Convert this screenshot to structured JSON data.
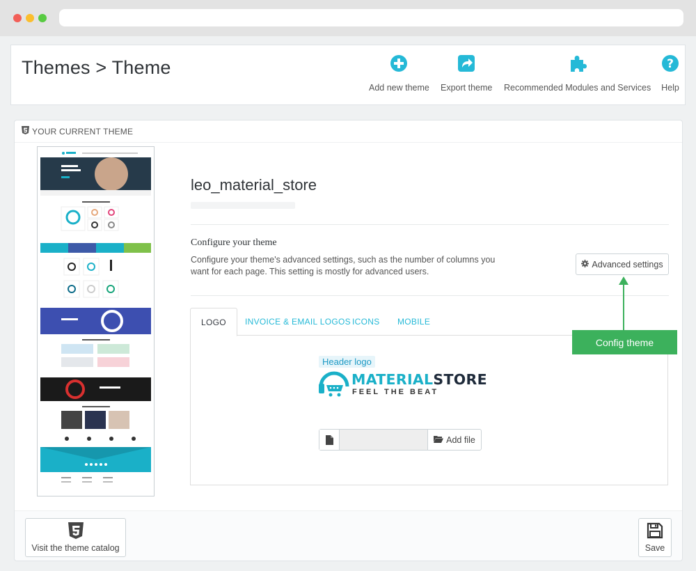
{
  "header": {
    "title": "Themes > Theme",
    "toolbar": [
      {
        "label": "Add new theme",
        "icon": "plus-circle-icon"
      },
      {
        "label": "Export theme",
        "icon": "share-icon"
      },
      {
        "label": "Recommended Modules and Services",
        "icon": "puzzle-icon"
      },
      {
        "label": "Help",
        "icon": "question-circle-icon"
      }
    ],
    "accent_color": "#25b9d7"
  },
  "panel": {
    "heading": "YOUR CURRENT THEME",
    "theme_name": "leo_material_store",
    "configure_title": "Configure your theme",
    "configure_desc": "Configure your theme's advanced settings, such as the number of columns you want for each page. This setting is mostly for advanced users.",
    "advanced_button": "Advanced settings",
    "tabs": [
      {
        "label": "LOGO",
        "active": true
      },
      {
        "label": "INVOICE & EMAIL LOGOS",
        "active": false
      },
      {
        "label": "ICONS",
        "active": false
      },
      {
        "label": "MOBILE",
        "active": false
      }
    ],
    "header_logo_label": "Header logo",
    "logo": {
      "word1": "MATERIAL",
      "word2": "STORE",
      "tagline": "FEEL THE BEAT"
    },
    "add_file_button": "Add file"
  },
  "callout": {
    "label": "Config theme",
    "color": "#3cb15c"
  },
  "footer": {
    "catalog_button": "Visit the theme catalog",
    "save_button": "Save"
  }
}
